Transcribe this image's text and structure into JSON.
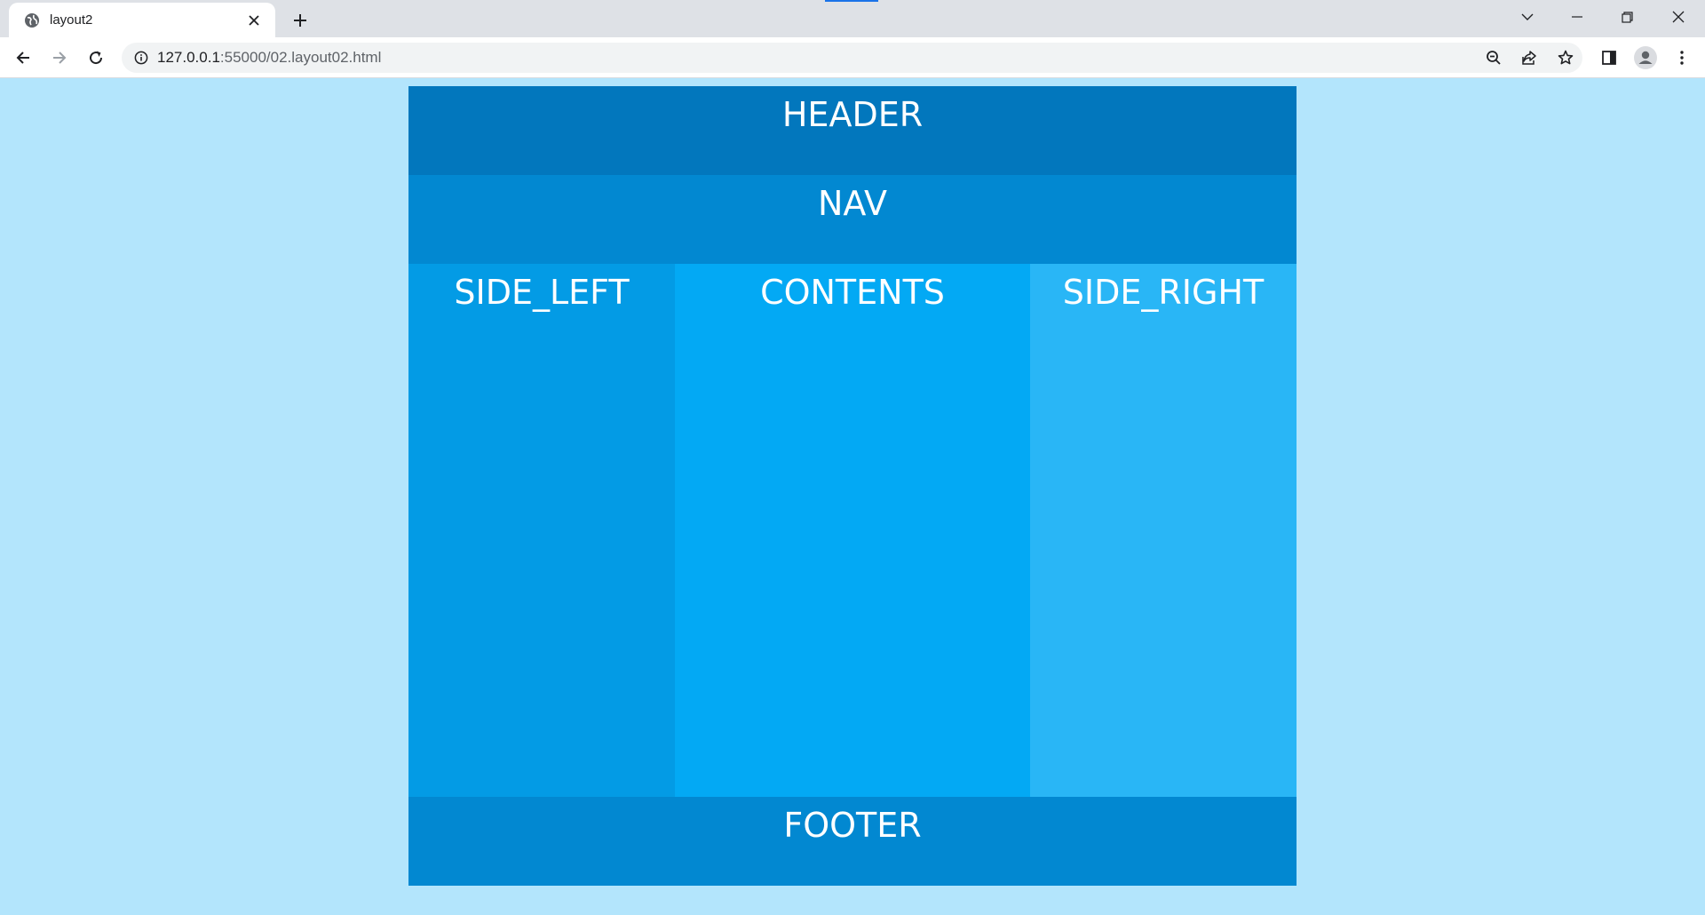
{
  "browser": {
    "tab_title": "layout2",
    "url_host": "127.0.0.1",
    "url_path": ":55000/02.layout02.html"
  },
  "icons": {
    "favicon": "globe-icon",
    "tab_close": "close-icon",
    "new_tab": "plus-icon",
    "tab_search": "chevron-down-icon",
    "minimize": "minimize-icon",
    "restore": "restore-icon",
    "close_window": "close-icon",
    "back": "arrow-left-icon",
    "forward": "arrow-right-icon",
    "reload": "reload-icon",
    "site_info": "info-icon",
    "zoom": "zoom-out-icon",
    "share": "share-icon",
    "bookmark": "star-icon",
    "side_panel": "side-panel-icon",
    "profile": "profile-icon",
    "menu": "kebab-menu-icon"
  },
  "layout_blocks": {
    "header": "HEADER",
    "nav": "NAV",
    "side_left": "SIDE_LEFT",
    "contents": "CONTENTS",
    "side_right": "SIDE_RIGHT",
    "footer": "FOOTER"
  },
  "colors": {
    "page_background": "#b3e5fc",
    "header": "#0277bd",
    "nav": "#0288d1",
    "side_left": "#039be5",
    "contents": "#03a9f4",
    "side_right": "#29b6f6",
    "footer": "#0288d1"
  }
}
